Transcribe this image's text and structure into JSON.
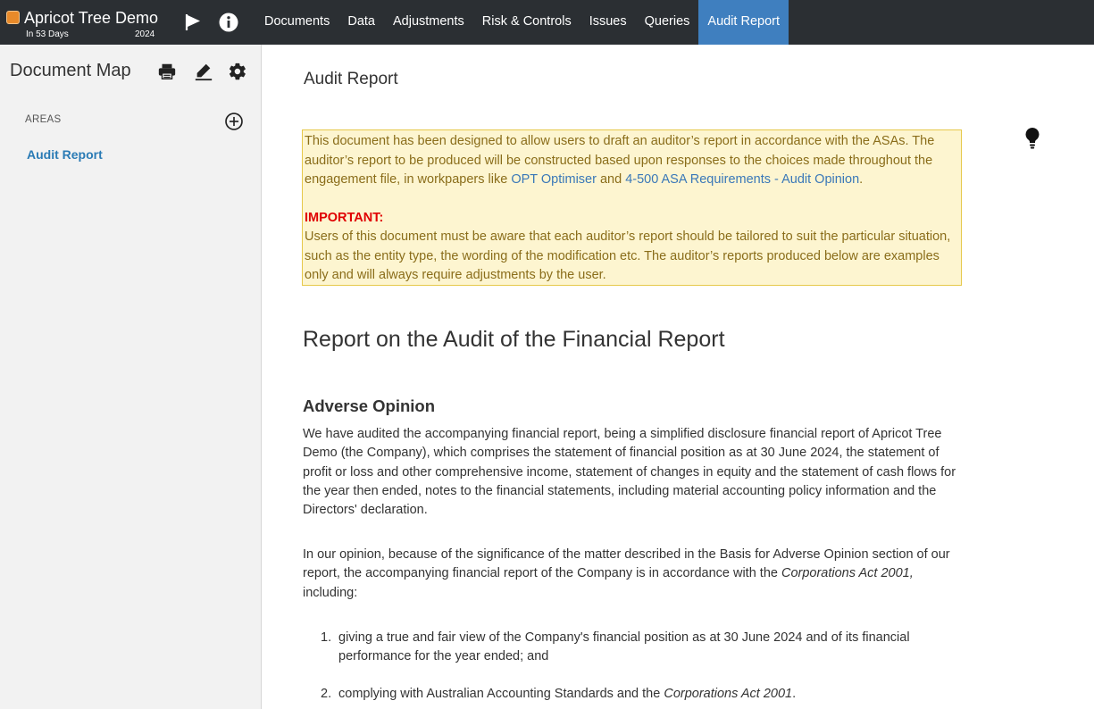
{
  "app": {
    "name": "Apricot Tree Demo",
    "subtitle": "In 53 Days",
    "year": "2024",
    "brand_color": "#e88a2a"
  },
  "topbar": {
    "icons": [
      "flag-icon",
      "info-icon"
    ],
    "nav": [
      {
        "label": "Documents"
      },
      {
        "label": "Data"
      },
      {
        "label": "Adjustments"
      },
      {
        "label": "Risk & Controls"
      },
      {
        "label": "Issues"
      },
      {
        "label": "Queries"
      },
      {
        "label": "Audit Report",
        "active": true
      }
    ],
    "active_color": "#3f7fbf"
  },
  "sidebar": {
    "title": "Document Map",
    "icons": [
      "print-icon",
      "sign-icon",
      "gear-icon"
    ],
    "areas_label": "AREAS",
    "add_icon": "plus-circle-icon",
    "items": [
      {
        "label": "Audit Report"
      }
    ]
  },
  "main": {
    "title": "Audit Report",
    "hint_icon": "lightbulb-icon",
    "note": {
      "text1": "This document has been designed to allow users to draft an auditor’s report in accordance with the ASAs. The auditor’s report to be produced will be constructed based upon responses to the choices made throughout the engagement file, in workpapers like ",
      "link1": "OPT Optimiser",
      "and": " and ",
      "link2": "4-500 ASA Requirements - Audit Opinion",
      "period": ".",
      "important_label": "IMPORTANT:",
      "important_text": "Users of this document must be aware that each auditor’s report should be tailored to suit the particular situation, such as the entity type, the wording of the modification etc. The auditor’s reports produced below are examples only and will always require adjustments by the user."
    },
    "heading": "Report on the Audit of the Financial Report",
    "subheading": "Adverse Opinion",
    "para1": "We have audited the accompanying financial report, being a simplified disclosure financial report of Apricot Tree Demo (the Company), which comprises the statement of financial position as at 30 June 2024, the statement of profit or loss and other comprehensive income, statement of changes in equity and the statement of cash flows for the year then ended, notes to the financial statements, including material accounting policy information and the Directors' declaration.",
    "para2_start": "In our opinion, because of the significance of the matter described in the Basis for Adverse Opinion section of our report, the accompanying financial report of the Company is in accordance with the ",
    "para2_italic": "Corporations Act 2001,",
    "para2_end": " including:",
    "list": [
      {
        "num": "1.",
        "text": "giving a true and fair view of the Company's financial position as at 30 June 2024 and of its financial performance for the year ended; and"
      },
      {
        "num": "2.",
        "text": "complying with Australian Accounting Standards and the ",
        "italic": "Corporations Act 2001",
        "end": "."
      }
    ]
  }
}
